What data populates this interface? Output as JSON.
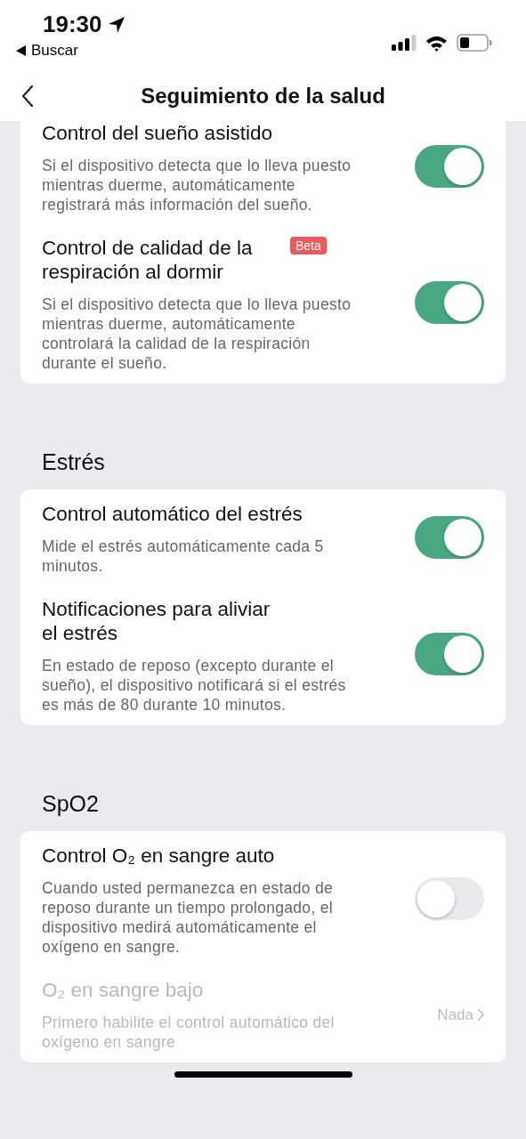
{
  "status_bar": {
    "time": "19:30",
    "back_app": "Buscar"
  },
  "header": {
    "title": "Seguimiento de la salud"
  },
  "sections": [
    {
      "items": [
        {
          "kind": "toggle",
          "title": "Control del sueño asistido",
          "description": "Si el dispositivo detecta que lo lleva puesto mientras duerme, automáticamente registrará más información del sueño.",
          "on": true
        },
        {
          "kind": "toggle",
          "title": "Control de calidad de la respiración al dormir",
          "badge": "Beta",
          "description": "Si el dispositivo detecta que lo lleva puesto mientras duerme, automáticamente controlará la calidad de la respiración durante el sueño.",
          "on": true
        }
      ]
    },
    {
      "title": "Estrés",
      "items": [
        {
          "kind": "toggle",
          "title": "Control automático del estrés",
          "description": "Mide el estrés automáticamente cada 5 minutos.",
          "on": true
        },
        {
          "kind": "toggle",
          "title": "Notificaciones para aliviar el estrés",
          "description": "En estado de reposo (excepto durante el sueño), el dispositivo notificará si el estrés es más de 80 durante 10 minutos.",
          "on": true
        }
      ]
    },
    {
      "title": "SpO2",
      "items": [
        {
          "kind": "toggle",
          "title": "Control O₂ en sangre auto",
          "description": "Cuando usted permanezca en estado de reposo durante un tiempo prolongado, el dispositivo medirá automáticamente el oxígeno en sangre.",
          "on": false
        },
        {
          "kind": "value",
          "title": "O₂ en sangre bajo",
          "description": "Primero habilite el control automático del oxígeno en sangre",
          "value": "Nada",
          "disabled": true
        }
      ]
    }
  ]
}
